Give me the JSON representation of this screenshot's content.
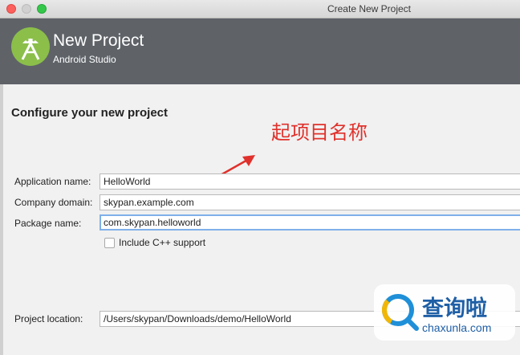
{
  "window": {
    "title": "Create New Project"
  },
  "header": {
    "title": "New Project",
    "subtitle": "Android Studio",
    "logo_icon": "android-studio-logo-icon",
    "logo_color": "#8bbf4a",
    "background": "#5f6368"
  },
  "page": {
    "section_title": "Configure your new project"
  },
  "annotation": {
    "text": "起项目名称",
    "color": "#e0312c"
  },
  "form": {
    "application_name": {
      "label": "Application name:",
      "value": "HelloWorld"
    },
    "company_domain": {
      "label": "Company domain:",
      "value": "skypan.example.com"
    },
    "package_name": {
      "label": "Package name:",
      "value": "com.skypan.helloworld"
    },
    "include_cpp": {
      "label": "Include C++ support",
      "checked": false
    },
    "project_location": {
      "label": "Project location:",
      "value": "/Users/skypan/Downloads/demo/HelloWorld"
    }
  },
  "watermark": {
    "text": "查询啦",
    "domain": "chaxunla.com",
    "icon": "magnifier-logo-icon",
    "color": "#1f5fa6"
  }
}
